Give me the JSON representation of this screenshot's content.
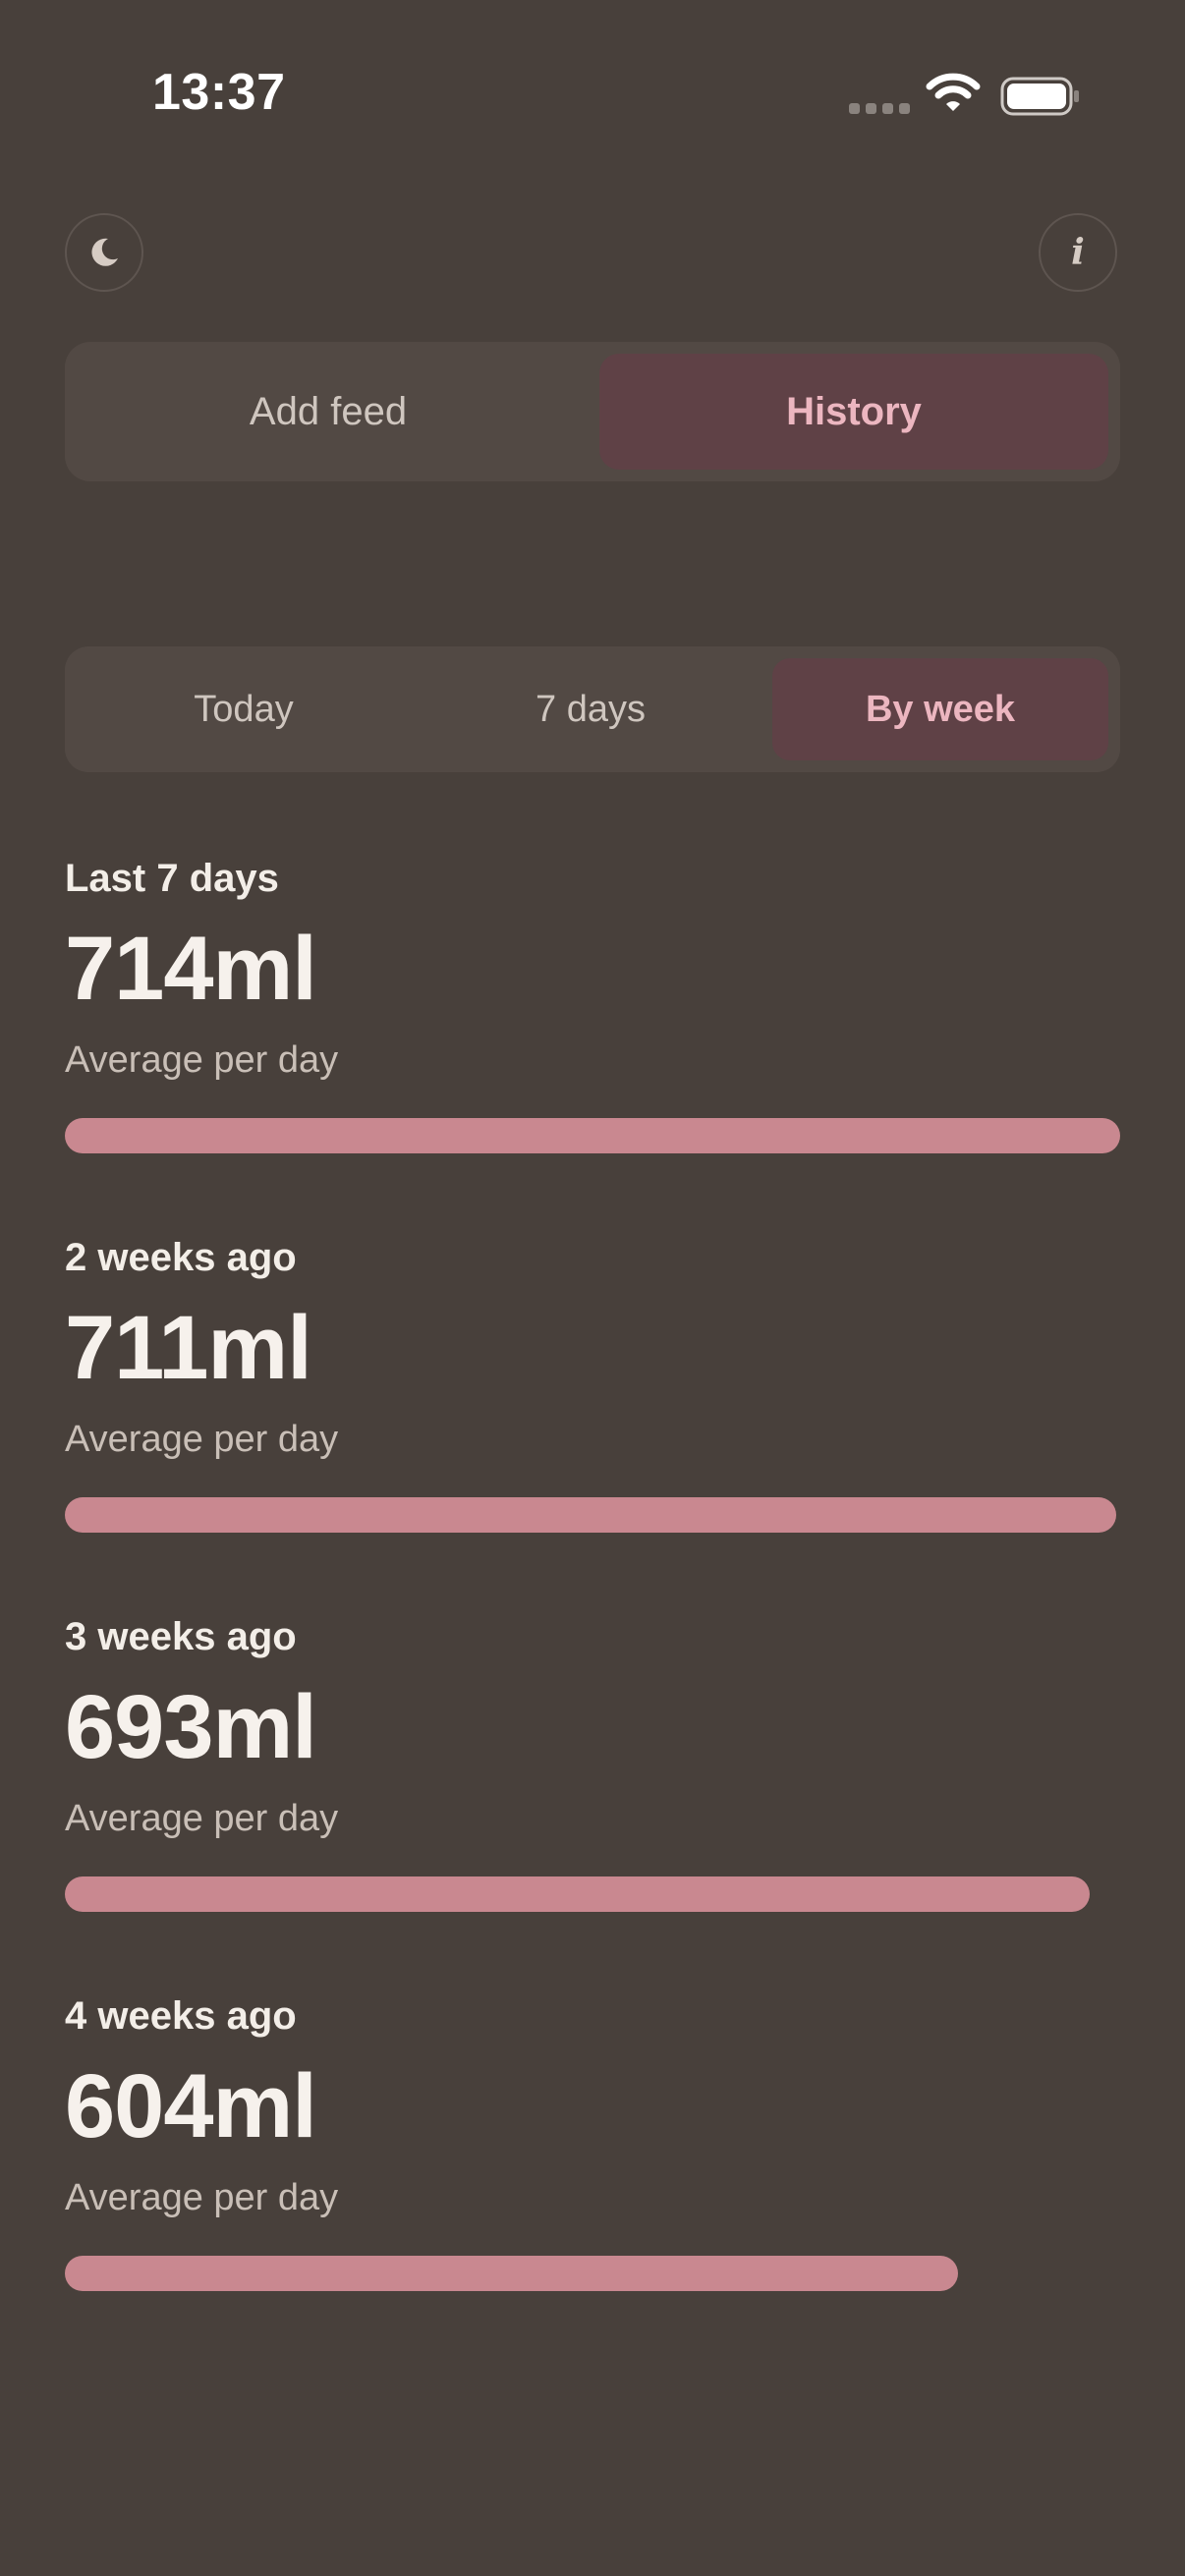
{
  "status_bar": {
    "time": "13:37"
  },
  "header": {
    "moon_icon": "moon-icon",
    "info_icon": "info-icon",
    "info_glyph": "i"
  },
  "main_tabs": {
    "add_label": "Add feed",
    "history_label": "History",
    "selected": "History"
  },
  "range_tabs": {
    "items": [
      "Today",
      "7 days",
      "By week"
    ],
    "selected": "By week"
  },
  "colors": {
    "background": "#48403b",
    "accent": "#ecb6c0",
    "selected_tab": "#5f4146",
    "bar": "#c98890"
  },
  "weeks": [
    {
      "title": "Last 7 days",
      "value": "714ml",
      "caption": "Average per day",
      "fill": 1.0
    },
    {
      "title": "2 weeks ago",
      "value": "711ml",
      "caption": "Average per day",
      "fill": 0.996
    },
    {
      "title": "3 weeks ago",
      "value": "693ml",
      "caption": "Average per day",
      "fill": 0.971
    },
    {
      "title": "4 weeks ago",
      "value": "604ml",
      "caption": "Average per day",
      "fill": 0.846
    }
  ]
}
